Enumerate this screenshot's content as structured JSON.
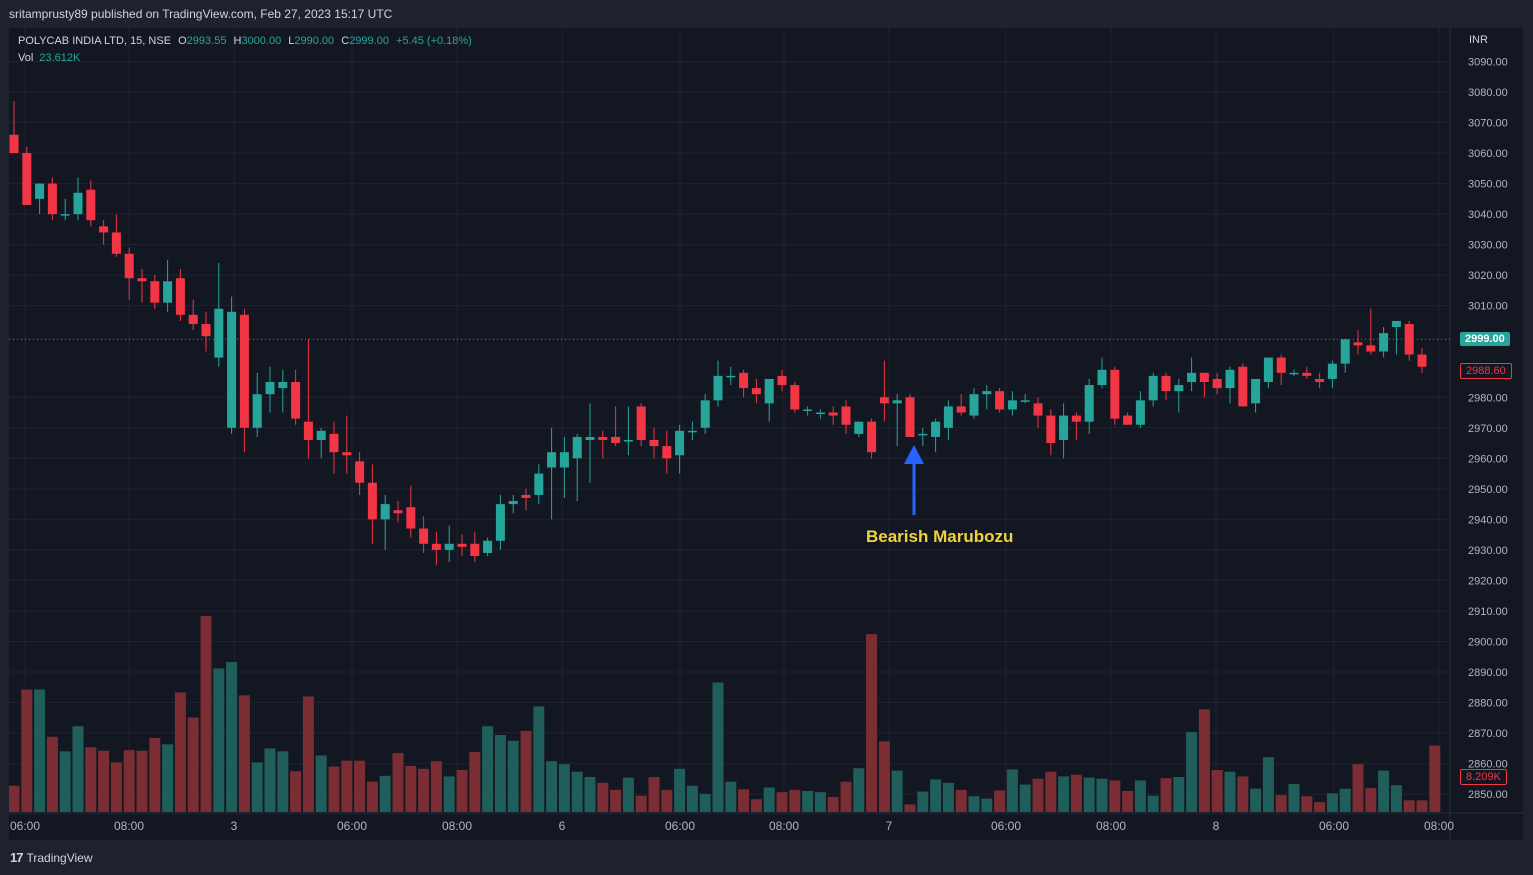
{
  "publisher": "sritamprusty89 published on TradingView.com, Feb 27, 2023 15:17 UTC",
  "legend": {
    "symbol": "POLYCAB INDIA LTD, 15, NSE",
    "open_label": "O",
    "open": "2993.55",
    "high_label": "H",
    "high": "3000.00",
    "low_label": "L",
    "low": "2990.00",
    "close_label": "C",
    "close": "2999.00",
    "change": "+5.45 (+0.18%)",
    "vol_label": "Vol",
    "vol": "23.612K"
  },
  "currency": "INR",
  "last_price_tag": "2999.00",
  "prev_close_tag": "2988.60",
  "last_volume_tag": "8.209K",
  "annotation": "Bearish Marubozu",
  "footer": {
    "logo_mark": "17",
    "logo_text": "TradingView"
  },
  "colors": {
    "up": "#26a69a",
    "down": "#f23645",
    "up_vol": "#1f5e5a",
    "down_vol": "#7b2d34",
    "arrow": "#2962ff",
    "annotation": "#f0d33c"
  },
  "chart_data": {
    "type": "candlestick",
    "y_axis": {
      "ticks": [
        3090,
        3080,
        3070,
        3060,
        3050,
        3040,
        3030,
        3020,
        3010,
        2970,
        2960,
        2950,
        2940,
        2930,
        2920,
        2910,
        2900,
        2890,
        2880,
        2870,
        2860,
        2850
      ],
      "tick_labels_also": [
        2980
      ],
      "range": [
        2845,
        3095
      ],
      "unit": "INR"
    },
    "x_axis_labels": [
      "06:00",
      "08:00",
      "3",
      "06:00",
      "08:00",
      "6",
      "06:00",
      "08:00",
      "7",
      "06:00",
      "08:00",
      "8",
      "06:00",
      "08:00"
    ],
    "last_price": 2999.0,
    "prev_close": 2988.6,
    "candles": [
      [
        3066,
        3077,
        3060,
        3060
      ],
      [
        3060,
        3062,
        3044,
        3043
      ],
      [
        3045,
        3050,
        3040,
        3050
      ],
      [
        3050,
        3052,
        3038,
        3040
      ],
      [
        3040,
        3045,
        3038,
        3040
      ],
      [
        3040,
        3052,
        3038,
        3047
      ],
      [
        3048,
        3051,
        3036,
        3038
      ],
      [
        3036,
        3038,
        3030,
        3034
      ],
      [
        3034,
        3040,
        3026,
        3027
      ],
      [
        3027,
        3029,
        3012,
        3019
      ],
      [
        3019,
        3022,
        3011,
        3018
      ],
      [
        3018,
        3020,
        3009,
        3011
      ],
      [
        3011,
        3025,
        3008,
        3018
      ],
      [
        3019,
        3022,
        3005,
        3007
      ],
      [
        3007,
        3012,
        3002,
        3004
      ],
      [
        3004,
        3008,
        2995,
        3000
      ],
      [
        2993,
        3024,
        2990,
        3009
      ],
      [
        2970,
        3013,
        2968,
        3008
      ],
      [
        3007,
        3009,
        2962,
        2970
      ],
      [
        2970,
        2988,
        2967,
        2981
      ],
      [
        2981,
        2990,
        2975,
        2985
      ],
      [
        2983,
        2989,
        2975,
        2985
      ],
      [
        2985,
        2989,
        2971,
        2973
      ],
      [
        2972,
        2999,
        2960,
        2966
      ],
      [
        2966,
        2970,
        2960,
        2969
      ],
      [
        2968,
        2972,
        2955,
        2962
      ],
      [
        2962,
        2974,
        2955,
        2961
      ],
      [
        2959,
        2962,
        2948,
        2952
      ],
      [
        2952,
        2958,
        2932,
        2940
      ],
      [
        2940,
        2948,
        2930,
        2945
      ],
      [
        2943,
        2946,
        2939,
        2942
      ],
      [
        2944,
        2951,
        2934,
        2937
      ],
      [
        2937,
        2941,
        2929,
        2932
      ],
      [
        2932,
        2936,
        2925,
        2930
      ],
      [
        2930,
        2938,
        2926,
        2932
      ],
      [
        2932,
        2935,
        2928,
        2931
      ],
      [
        2932,
        2936,
        2926,
        2928
      ],
      [
        2929,
        2934,
        2928,
        2933
      ],
      [
        2933,
        2948,
        2930,
        2945
      ],
      [
        2945,
        2948,
        2942,
        2946
      ],
      [
        2948,
        2950,
        2943,
        2947
      ],
      [
        2948,
        2958,
        2945,
        2955
      ],
      [
        2957,
        2970,
        2940,
        2962
      ],
      [
        2957,
        2967,
        2947,
        2962
      ],
      [
        2960,
        2968,
        2946,
        2967
      ],
      [
        2966,
        2978,
        2952,
        2967
      ],
      [
        2967,
        2969,
        2960,
        2966
      ],
      [
        2967,
        2977,
        2964,
        2965
      ],
      [
        2966,
        2977,
        2961,
        2966
      ],
      [
        2977,
        2978,
        2964,
        2966
      ],
      [
        2966,
        2970,
        2960,
        2964
      ],
      [
        2964,
        2969,
        2955,
        2960
      ],
      [
        2961,
        2971,
        2955,
        2969
      ],
      [
        2969,
        2972,
        2966,
        2969
      ],
      [
        2970,
        2981,
        2968,
        2979
      ],
      [
        2979,
        2992,
        2977,
        2987
      ],
      [
        2987,
        2990,
        2984,
        2987
      ],
      [
        2988,
        2989,
        2980,
        2983
      ],
      [
        2983,
        2986,
        2978,
        2981
      ],
      [
        2978,
        2986,
        2972,
        2986
      ],
      [
        2987,
        2989,
        2982,
        2984
      ],
      [
        2984,
        2985,
        2975,
        2976
      ],
      [
        2976,
        2977,
        2974,
        2976
      ],
      [
        2975,
        2976,
        2973,
        2975
      ],
      [
        2975,
        2977,
        2971,
        2974
      ],
      [
        2977,
        2979,
        2968,
        2971
      ],
      [
        2968,
        2972,
        2967,
        2972
      ],
      [
        2972,
        2973,
        2960,
        2962
      ],
      [
        2980,
        2992,
        2972,
        2978
      ],
      [
        2978,
        2981,
        2964,
        2979
      ],
      [
        2980,
        2981,
        2967,
        2967
      ],
      [
        2968,
        2970,
        2964,
        2968
      ],
      [
        2967,
        2973,
        2962,
        2972
      ],
      [
        2970,
        2979,
        2966,
        2977
      ],
      [
        2977,
        2981,
        2974,
        2975
      ],
      [
        2974,
        2983,
        2973,
        2981
      ],
      [
        2981,
        2984,
        2976,
        2982
      ],
      [
        2982,
        2983,
        2975,
        2976
      ],
      [
        2976,
        2982,
        2974,
        2979
      ],
      [
        2979,
        2981,
        2978,
        2979
      ],
      [
        2978,
        2980,
        2970,
        2974
      ],
      [
        2974,
        2976,
        2961,
        2965
      ],
      [
        2966,
        2978,
        2960,
        2974
      ],
      [
        2974,
        2975,
        2966,
        2972
      ],
      [
        2972,
        2986,
        2968,
        2984
      ],
      [
        2984,
        2993,
        2983,
        2989
      ],
      [
        2989,
        2990,
        2971,
        2973
      ],
      [
        2974,
        2975,
        2971,
        2971
      ],
      [
        2971,
        2982,
        2970,
        2979
      ],
      [
        2979,
        2988,
        2977,
        2987
      ],
      [
        2987,
        2988,
        2979,
        2982
      ],
      [
        2982,
        2986,
        2975,
        2984
      ],
      [
        2985,
        2993,
        2982,
        2988
      ],
      [
        2988,
        2988,
        2980,
        2985
      ],
      [
        2986,
        2988,
        2981,
        2983
      ],
      [
        2983,
        2990,
        2978,
        2989
      ],
      [
        2990,
        2991,
        2977,
        2977
      ],
      [
        2978,
        2986,
        2975,
        2986
      ],
      [
        2985,
        2993,
        2983,
        2993
      ],
      [
        2993,
        2994,
        2984,
        2988
      ],
      [
        2988,
        2989,
        2987,
        2988
      ],
      [
        2988,
        2990,
        2986,
        2987
      ],
      [
        2986,
        2988,
        2983,
        2985
      ],
      [
        2986,
        2992,
        2983,
        2991
      ],
      [
        2991,
        2999,
        2988,
        2999
      ],
      [
        2998,
        3002,
        2994,
        2997
      ],
      [
        2997,
        3009,
        2994,
        2995
      ],
      [
        2995,
        3003,
        2993,
        3001
      ],
      [
        3003,
        3005,
        2994,
        3005
      ],
      [
        3004,
        3005,
        2992,
        2994
      ],
      [
        2994,
        2996,
        2988,
        2990
      ]
    ],
    "volume_k": [
      4.5,
      21.0,
      21.0,
      12.9,
      10.4,
      14.7,
      11.1,
      10.5,
      8.5,
      10.6,
      10.5,
      12.7,
      11.6,
      20.5,
      16.2,
      33.6,
      24.6,
      25.7,
      20.0,
      8.5,
      10.9,
      10.4,
      7.0,
      19.8,
      9.7,
      7.8,
      8.8,
      8.8,
      5.2,
      6.2,
      10.1,
      7.9,
      7.4,
      8.7,
      6.1,
      7.2,
      10.3,
      14.7,
      13.2,
      12.2,
      13.9,
      18.1,
      8.7,
      8.2,
      6.9,
      6.0,
      5.0,
      3.8,
      5.9,
      2.8,
      6.0,
      3.8,
      7.4,
      4.5,
      3.1,
      22.2,
      5.2,
      3.9,
      2.2,
      4.2,
      3.4,
      3.8,
      3.6,
      3.4,
      2.6,
      5.2,
      7.5,
      30.5,
      12.1,
      7.1,
      1.3,
      3.5,
      5.6,
      5.0,
      3.8,
      2.7,
      2.3,
      3.7,
      7.3,
      4.7,
      5.7,
      6.9,
      6.1,
      6.4,
      5.9,
      5.7,
      5.4,
      3.6,
      5.4,
      2.8,
      5.8,
      6.0,
      13.7,
      17.6,
      7.2,
      6.9,
      6.1,
      4.0,
      9.4,
      2.9,
      4.8,
      2.7,
      1.7,
      3.2,
      4.0,
      8.2,
      4.1,
      7.1,
      4.6,
      2.0,
      2.0,
      11.4
    ]
  }
}
